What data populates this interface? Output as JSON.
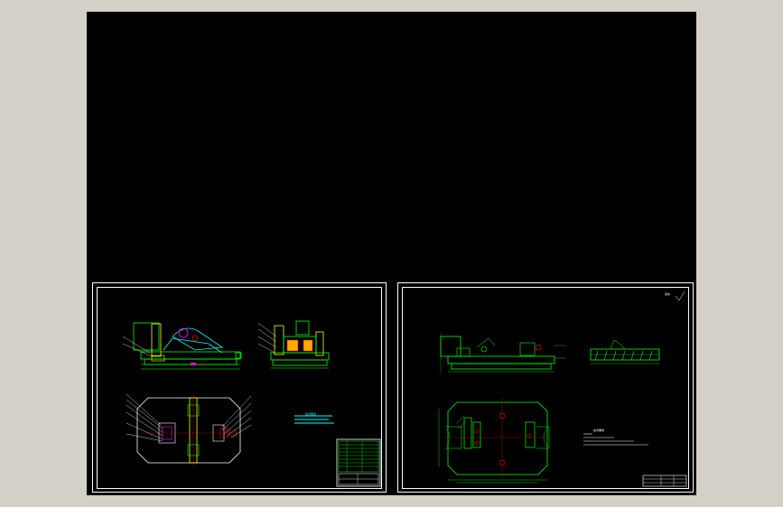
{
  "app": {
    "title": "",
    "background_color": "#d4d0c8",
    "canvas_color": "#000000"
  },
  "drawing_colors": {
    "frame": "#ffffff",
    "outline": "#00ff00",
    "part": "#ffff00",
    "accent": "#ff0000",
    "hatch": "#00ffff",
    "detail": "#ff00ff"
  },
  "sheets": [
    {
      "name": "assembly-drawing",
      "views": [
        "front-view",
        "side-view",
        "plan-view"
      ],
      "tech_requirements_title": "技术要求",
      "has_title_block": true,
      "has_parts_list": true
    },
    {
      "name": "part-drawing",
      "views": [
        "front-view",
        "side-view",
        "plan-view"
      ],
      "tech_requirements_title": "技术要求",
      "roughness_mark": "其余",
      "has_title_block": true
    }
  ]
}
